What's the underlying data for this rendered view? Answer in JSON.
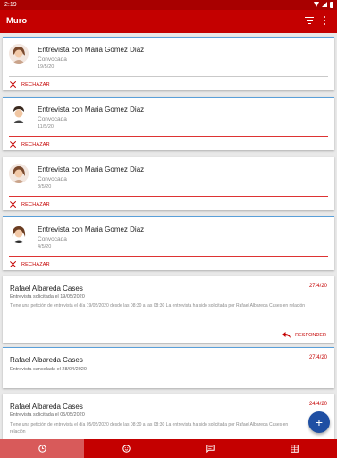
{
  "status_bar": {
    "time": "2:19"
  },
  "app_bar": {
    "title": "Muro",
    "actions": [
      "filter-icon",
      "more-vert-icon"
    ]
  },
  "interviews": [
    {
      "title": "Entrevista con Maria Gomez Diaz",
      "status": "Convocada",
      "date": "19/5/20",
      "action": "RECHAZAR"
    },
    {
      "title": "Entrevista con Maria Gomez Diaz",
      "status": "Convocada",
      "date": "11/5/20",
      "action": "RECHAZAR"
    },
    {
      "title": "Entrevista con Maria Gomez Diaz",
      "status": "Convocada",
      "date": "8/5/20",
      "action": "RECHAZAR"
    },
    {
      "title": "Entrevista con Maria Gomez Diaz",
      "status": "Convocada",
      "date": "4/5/20",
      "action": "RECHAZAR"
    }
  ],
  "messages": [
    {
      "title": "Rafael Albareda Cases",
      "date": "27/4/20",
      "subtitle": "Entrevista solicitada el 19/05/2020",
      "body": "Tiene una petición de entrevista el día 19/05/2020 desde las 08:30 a las 08:30 La entrevista ha sido solicitada por Rafael Albareda Cases en relación",
      "action": "RESPONDER"
    },
    {
      "title": "Rafael Albareda Cases",
      "date": "27/4/20",
      "subtitle": "Entrevista cancelada el 28/04/2020"
    },
    {
      "title": "Rafael Albareda Cases",
      "date": "24/4/20",
      "subtitle": "Entrevista solicitada el 05/05/2020",
      "body": "Tiene una petición de entrevista el día 05/05/2020 desde las 08:30 a las 08:30 La entrevista ha sido solicitada por Rafael Albareda Cases en relación"
    }
  ],
  "fab": {
    "icon": "plus-icon",
    "label": "+"
  },
  "bottom_nav": {
    "items": [
      {
        "icon": "clock-icon",
        "active": true
      },
      {
        "icon": "smiley-icon",
        "active": false
      },
      {
        "icon": "chat-icon",
        "active": false
      },
      {
        "icon": "grid-icon",
        "active": false
      }
    ]
  },
  "colors": {
    "primary": "#c40000",
    "status_bar": "#a80000",
    "card_accent": "#5a9fd8",
    "fab": "#1f4fa3"
  }
}
